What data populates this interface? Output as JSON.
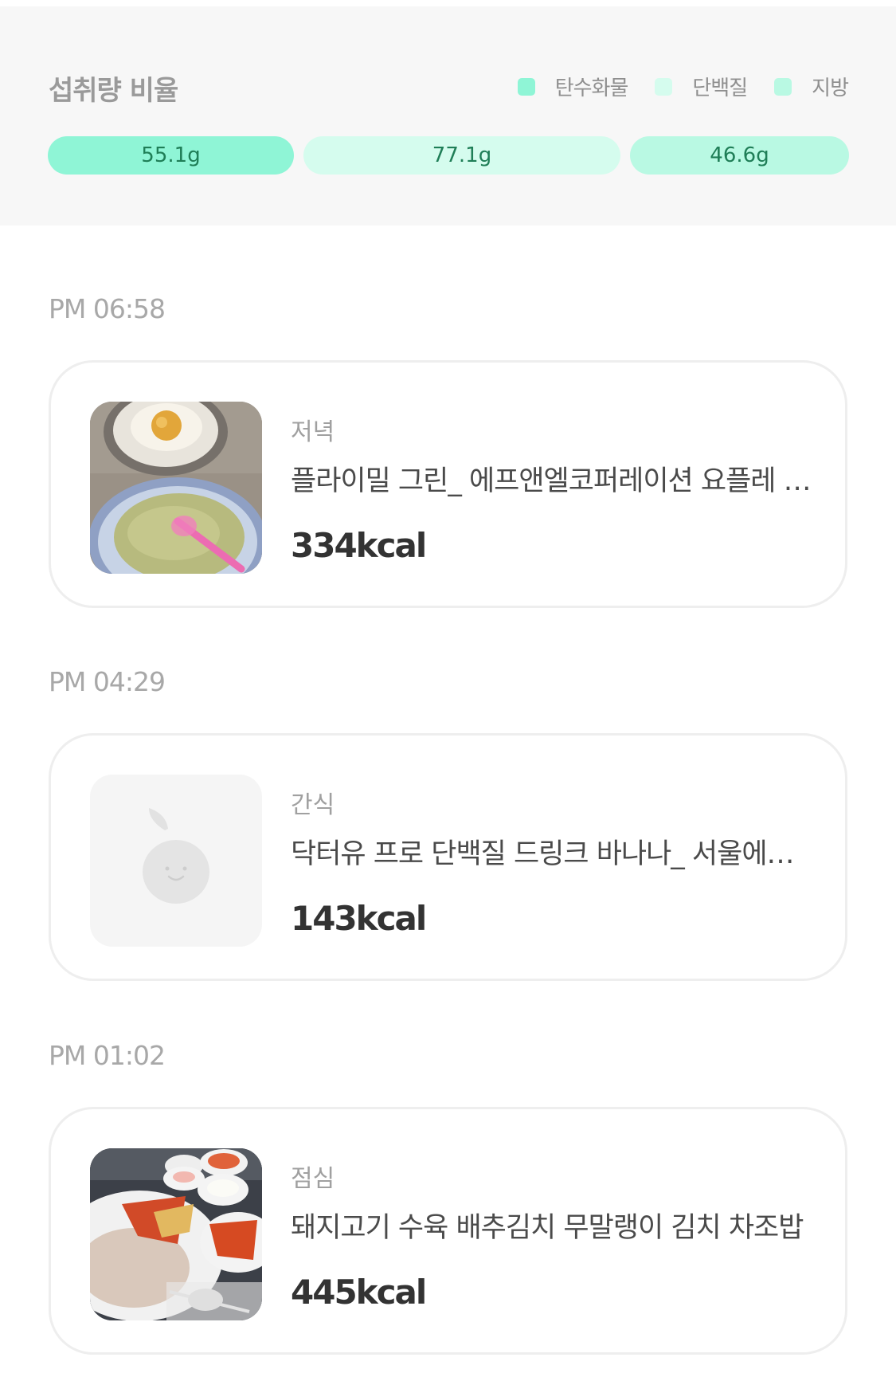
{
  "intake": {
    "title": "섭취량 비율",
    "legend": [
      {
        "label": "탄수화물",
        "color": "#8ff5d6"
      },
      {
        "label": "단백질",
        "color": "#d5fcee"
      },
      {
        "label": "지방",
        "color": "#b9f9e3"
      }
    ],
    "bars": [
      {
        "value": "55.1g",
        "color": "#8ff5d6"
      },
      {
        "value": "77.1g",
        "color": "#d5fcee"
      },
      {
        "value": "46.6g",
        "color": "#b9f9e3"
      }
    ]
  },
  "meals": [
    {
      "time": "PM 06:58",
      "type": "저녁",
      "name": "플라이밀 그린_ 에프앤엘코퍼레이션 요플레 플레인",
      "kcal": "334kcal",
      "photo": "food-photo-eggs-and-green-shake"
    },
    {
      "time": "PM 04:29",
      "type": "간식",
      "name": "닥터유 프로 단백질 드링크 바나나_ 서울에프엔비",
      "kcal": "143kcal",
      "photo": "placeholder-apple-icon"
    },
    {
      "time": "PM 01:02",
      "type": "점심",
      "name": "돼지고기 수육 배추김치 무말랭이 김치 차조밥",
      "kcal": "445kcal",
      "photo": "food-photo-pork-and-kimchi"
    }
  ]
}
